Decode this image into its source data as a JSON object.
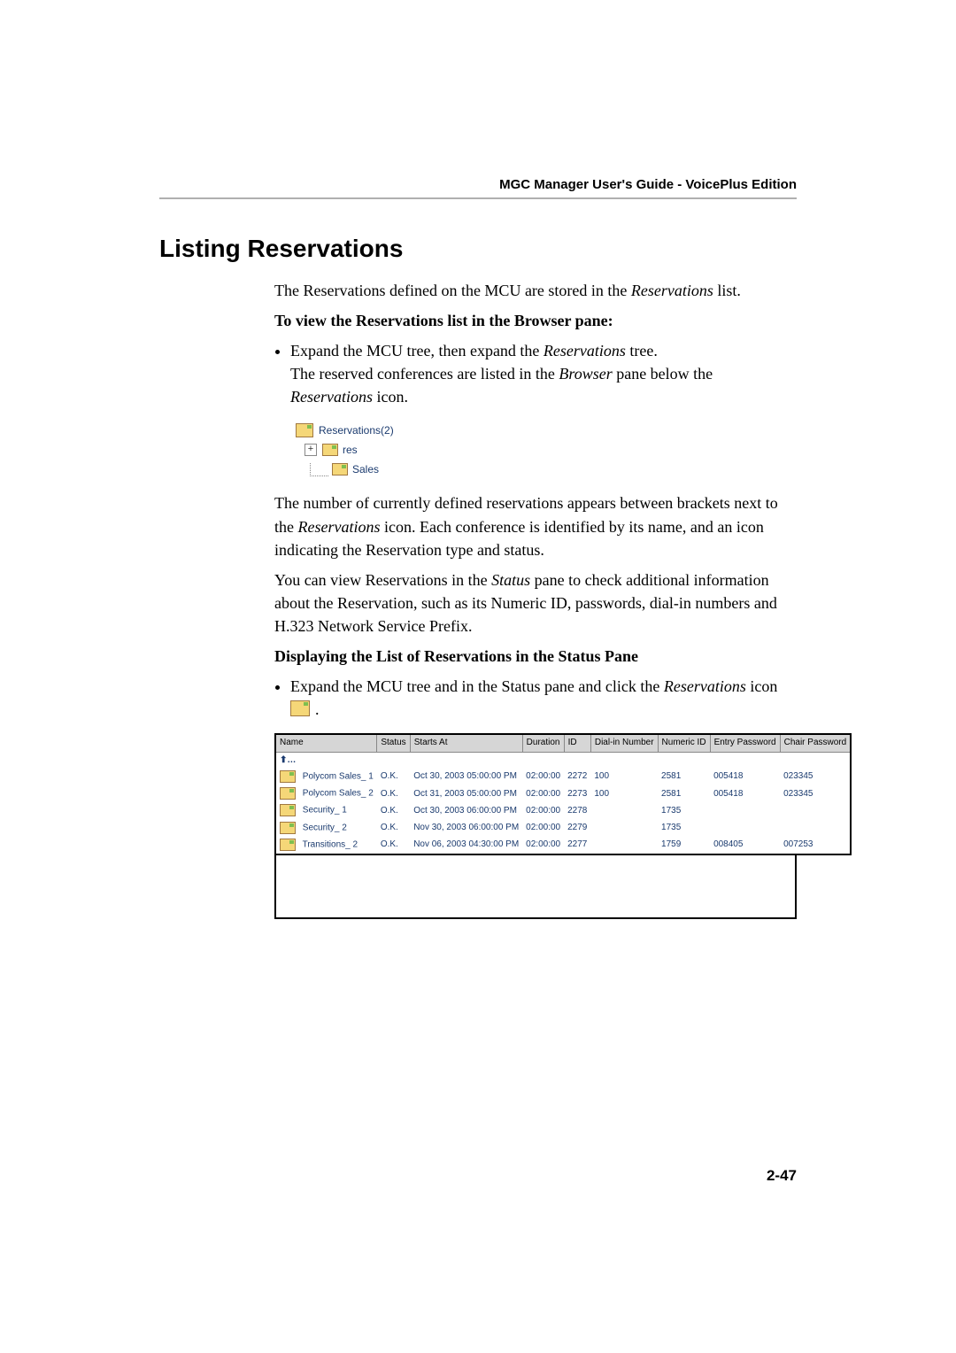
{
  "header": {
    "guide_title": "MGC Manager User's Guide - VoicePlus Edition"
  },
  "section": {
    "title": "Listing Reservations",
    "intro_pre": "The Reservations defined on the MCU are stored in the ",
    "intro_italic": "Reservations",
    "intro_post": " list.",
    "view_heading": "To view the Reservations list in the Browser pane:",
    "bullet1_a": "Expand the MCU tree, then expand the ",
    "bullet1_b": "Reservations",
    "bullet1_c": " tree.",
    "bullet1_line2_a": "The reserved conferences are listed in the ",
    "bullet1_line2_b": "Browser",
    "bullet1_line2_c": " pane below the ",
    "bullet1_line2_d": "Reservations",
    "bullet1_line2_e": " icon.",
    "tree": {
      "root": "Reservations(2)",
      "child1": "res",
      "child2": "Sales"
    },
    "para2_a": "The number of currently defined reservations appears between brackets next to the ",
    "para2_b": "Reservations",
    "para2_c": " icon. Each conference is identified by its name, and an icon indicating the Reservation type and status.",
    "para3_a": "You can view Reservations in the ",
    "para3_b": "Status",
    "para3_c": " pane to check additional information about the Reservation, such as its Numeric ID, passwords, dial-in numbers and H.323 Network Service Prefix.",
    "display_heading": "Displaying the List of Reservations in the Status Pane",
    "bullet2_a": "Expand the MCU tree and in the Status pane and click the ",
    "bullet2_b": "Reservations",
    "bullet2_c": " icon ",
    "bullet2_d": "."
  },
  "table": {
    "cols": [
      "Name",
      "Status",
      "Starts At",
      "Duration",
      "ID",
      "Dial-in Number",
      "Numeric ID",
      "Entry Password",
      "Chair Password"
    ],
    "ellipsis": "⬆…",
    "rows": [
      {
        "name": "Polycom Sales_  1",
        "status": "O.K.",
        "starts": "Oct 30, 2003  05:00:00 PM",
        "dur": "02:00:00",
        "id": "2272",
        "dial": "100",
        "num": "2581",
        "entry": "005418",
        "chair": "023345"
      },
      {
        "name": "Polycom Sales_  2",
        "status": "O.K.",
        "starts": "Oct 31, 2003  05:00:00 PM",
        "dur": "02:00:00",
        "id": "2273",
        "dial": "100",
        "num": "2581",
        "entry": "005418",
        "chair": "023345"
      },
      {
        "name": "Security_  1",
        "status": "O.K.",
        "starts": "Oct 30, 2003  06:00:00 PM",
        "dur": "02:00:00",
        "id": "2278",
        "dial": "",
        "num": "1735",
        "entry": "",
        "chair": ""
      },
      {
        "name": "Security_  2",
        "status": "O.K.",
        "starts": "Nov 30, 2003  06:00:00 PM",
        "dur": "02:00:00",
        "id": "2279",
        "dial": "",
        "num": "1735",
        "entry": "",
        "chair": ""
      },
      {
        "name": "Transitions_  2",
        "status": "O.K.",
        "starts": "Nov 06, 2003  04:30:00 PM",
        "dur": "02:00:00",
        "id": "2277",
        "dial": "",
        "num": "1759",
        "entry": "008405",
        "chair": "007253"
      }
    ]
  },
  "footer": {
    "page": "2-47"
  }
}
